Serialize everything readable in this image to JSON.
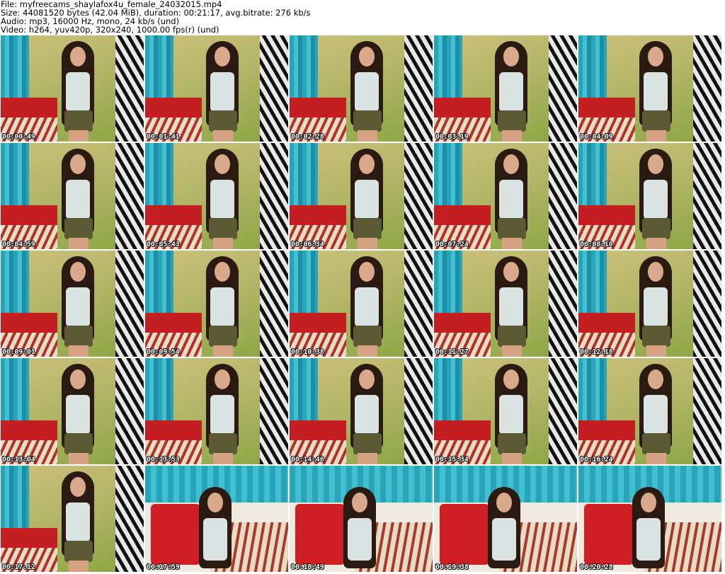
{
  "header": {
    "file": "File: myfreecams_shaylafox4u_female_24032015.mp4",
    "size": "Size: 44081520 bytes (42.04 MiB), duration: 00:21:17, avg.bitrate: 276 kb/s",
    "audio": "Audio: mp3, 16000 Hz, mono, 24 kb/s (und)",
    "video": "Video: h264, yuv420p, 320x240, 1000.00 fps(r) (und)"
  },
  "thumbnails": [
    {
      "timestamp": "00:00:49"
    },
    {
      "timestamp": "00:01:41"
    },
    {
      "timestamp": "00:02:28"
    },
    {
      "timestamp": "00:03:19"
    },
    {
      "timestamp": "00:04:09"
    },
    {
      "timestamp": "00:04:59"
    },
    {
      "timestamp": "00:05:43"
    },
    {
      "timestamp": "00:06:34"
    },
    {
      "timestamp": "00:07:24"
    },
    {
      "timestamp": "00:08:10"
    },
    {
      "timestamp": "00:09:01"
    },
    {
      "timestamp": "00:09:54"
    },
    {
      "timestamp": "00:10:38"
    },
    {
      "timestamp": "00:11:27"
    },
    {
      "timestamp": "00:12:18"
    },
    {
      "timestamp": "00:13:04"
    },
    {
      "timestamp": "00:13:53"
    },
    {
      "timestamp": "00:14:46"
    },
    {
      "timestamp": "00:15:34"
    },
    {
      "timestamp": "00:16:24"
    },
    {
      "timestamp": "00:17:12"
    },
    {
      "timestamp": "00:17:59"
    },
    {
      "timestamp": "00:18:49"
    },
    {
      "timestamp": "00:19:38"
    },
    {
      "timestamp": "00:20:28"
    }
  ]
}
